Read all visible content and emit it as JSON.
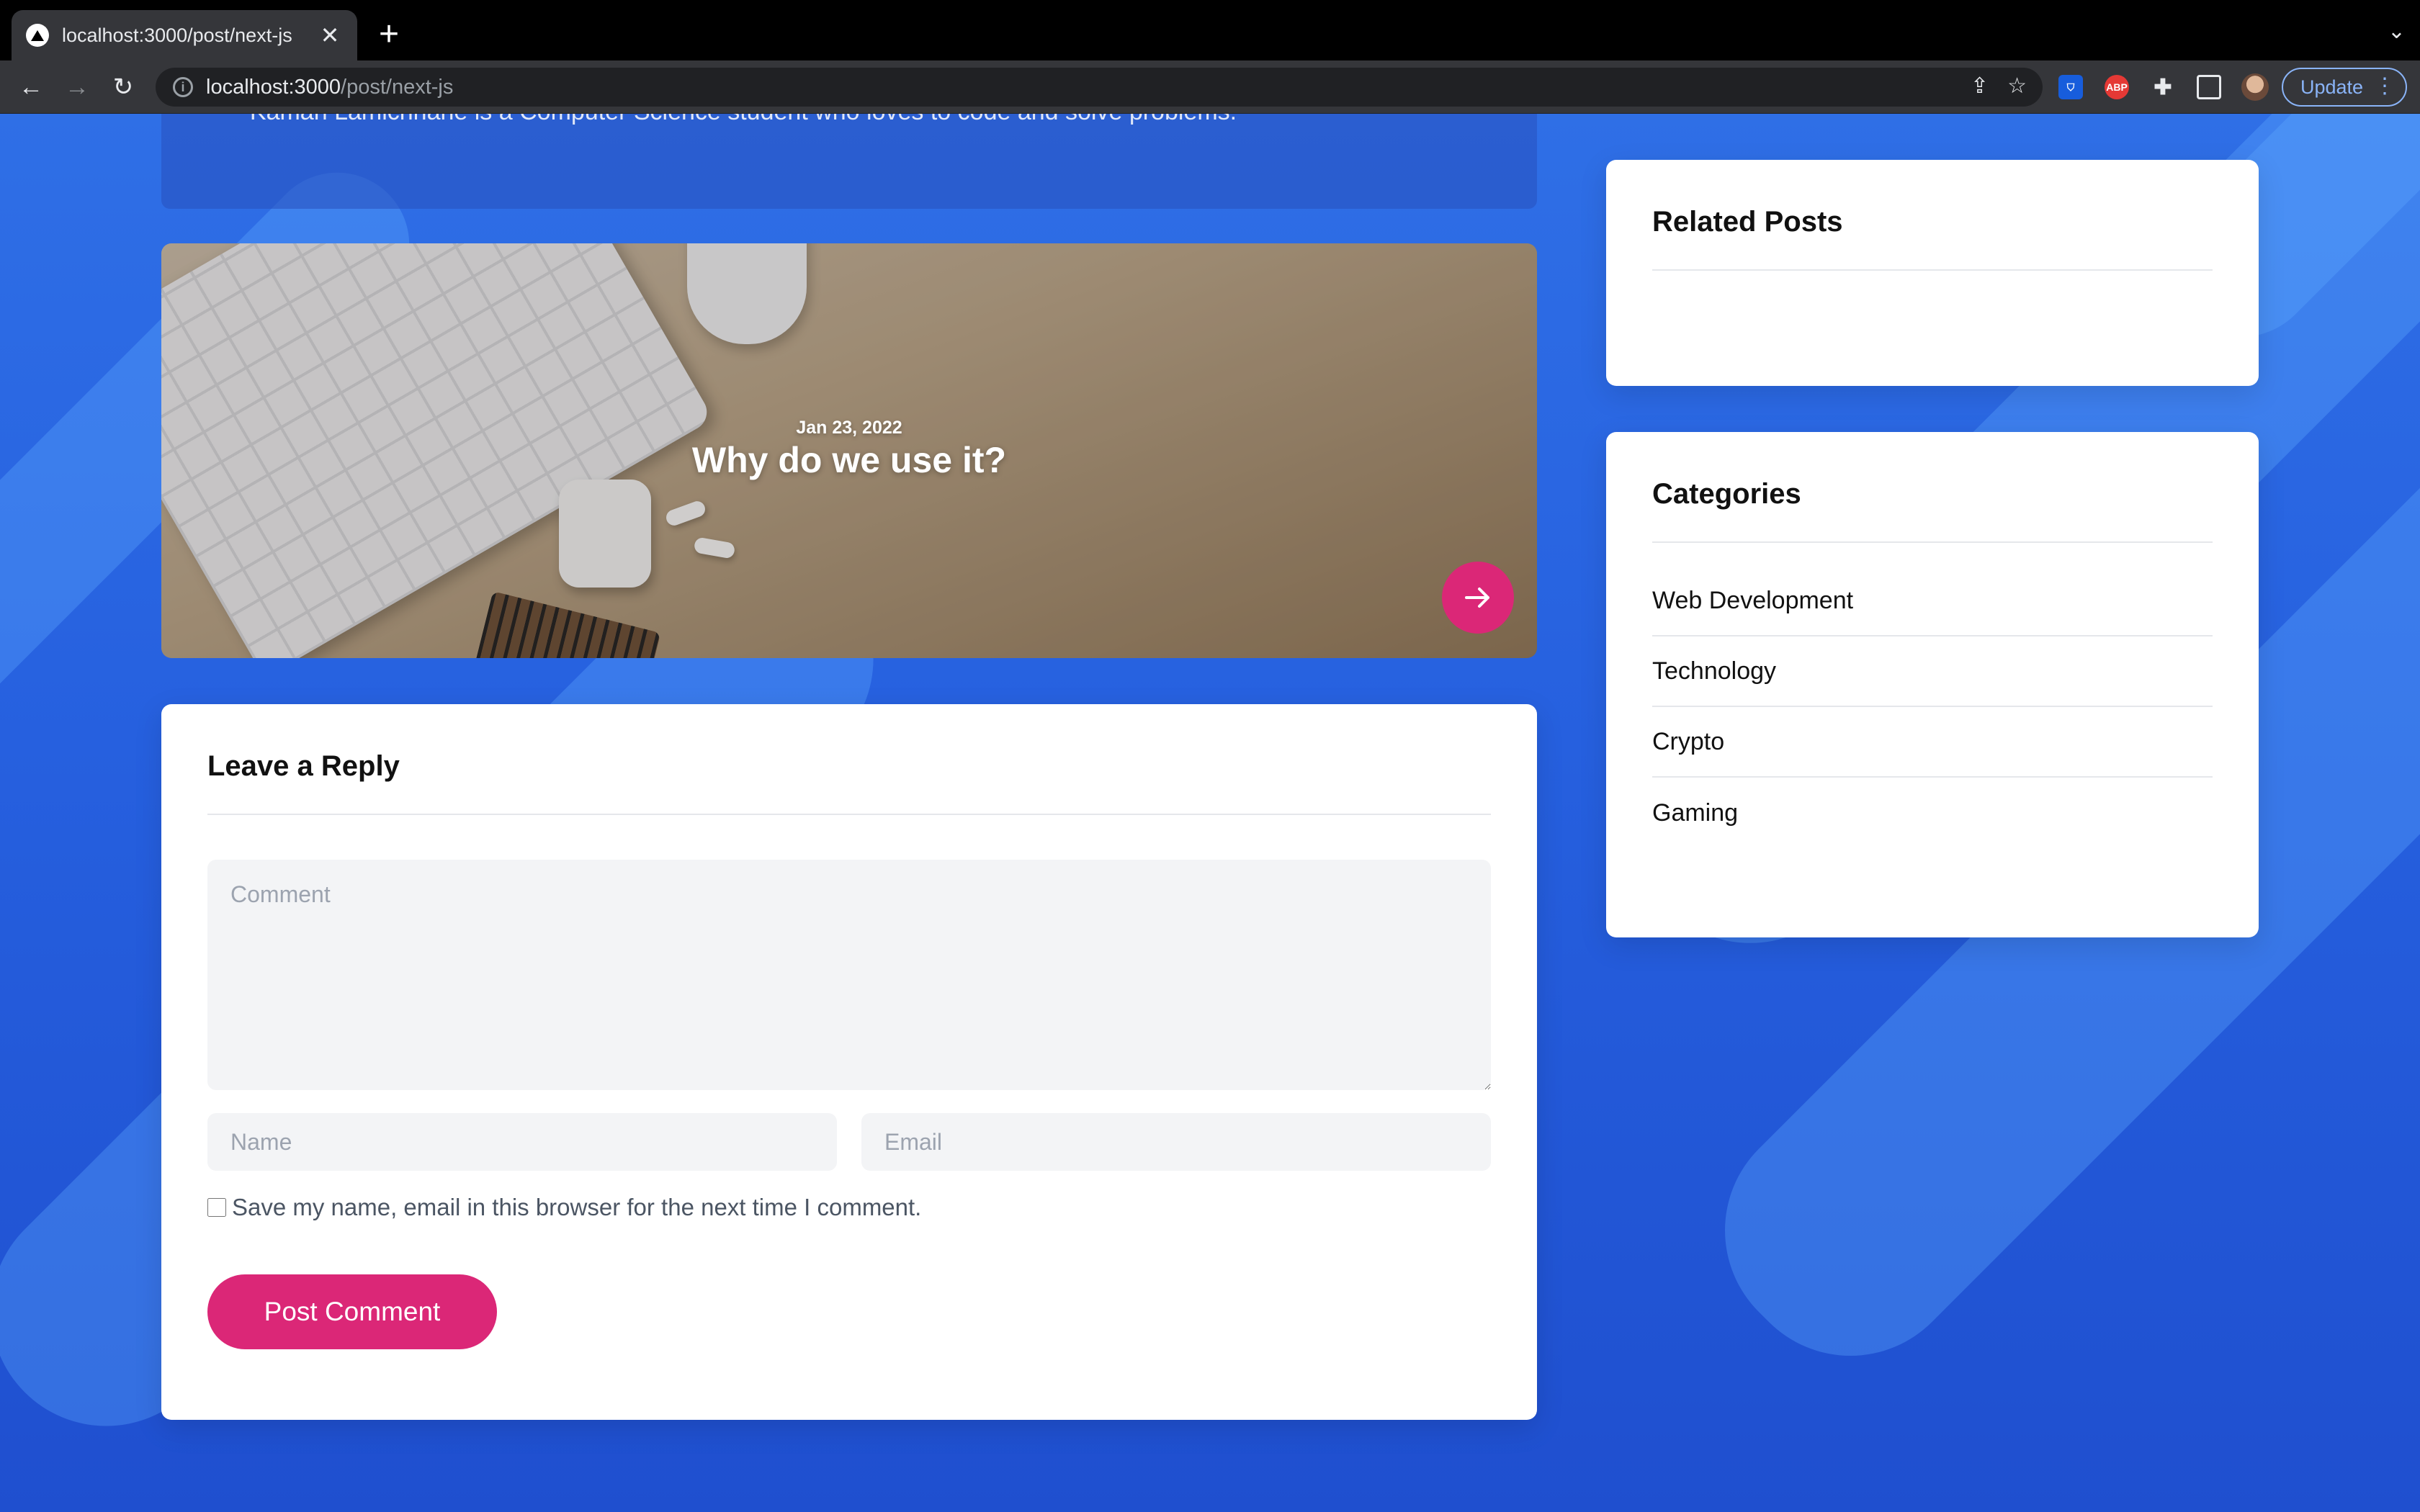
{
  "browser": {
    "tab_title": "localhost:3000/post/next-js",
    "url_host": "localhost:3000",
    "url_path": "/post/next-js",
    "update_label": "Update",
    "extensions": [
      "bitwarden-icon",
      "adblock-plus-icon",
      "extensions-puzzle-icon",
      "side-panel-icon"
    ],
    "adblock_label": "ABP"
  },
  "author": {
    "bio": "Kaman Lamichhane is a Computer Science student who loves to code and solve problems."
  },
  "adjacent_post": {
    "date": "Jan 23, 2022",
    "title": "Why do we use it?"
  },
  "reply_form": {
    "title": "Leave a Reply",
    "comment_placeholder": "Comment",
    "name_placeholder": "Name",
    "email_placeholder": "Email",
    "save_label": "Save my name, email in this browser for the next time I comment.",
    "submit_label": "Post Comment"
  },
  "sidebar": {
    "related_title": "Related Posts",
    "categories_title": "Categories",
    "categories": [
      "Web Development",
      "Technology",
      "Crypto",
      "Gaming"
    ]
  },
  "colors": {
    "accent": "#db2777",
    "page_background": "#2563eb",
    "card_background": "#ffffff"
  }
}
